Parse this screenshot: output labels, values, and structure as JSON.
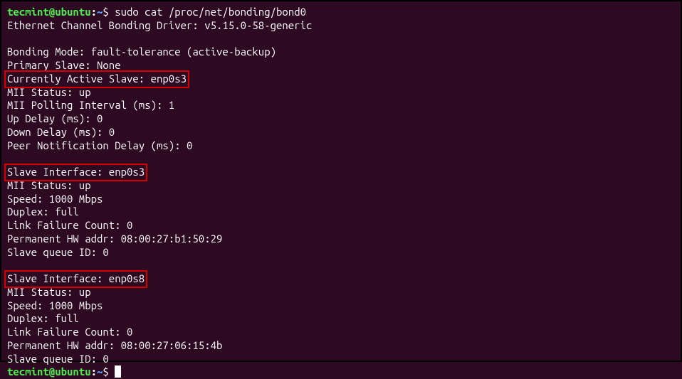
{
  "prompt": {
    "user": "tecmint@ubuntu",
    "path": "~",
    "symbol": "$"
  },
  "command": "sudo cat /proc/net/bonding/bond0",
  "header": {
    "driver": "Ethernet Channel Bonding Driver: v5.15.0-58-generic"
  },
  "bonding": {
    "mode": "Bonding Mode: fault-tolerance (active-backup)",
    "primary_slave": "Primary Slave: None",
    "active_slave": "Currently Active Slave: enp0s3",
    "mii_status": "MII Status: up",
    "mii_polling": "MII Polling Interval (ms): 1",
    "up_delay": "Up Delay (ms): 0",
    "down_delay": "Down Delay (ms): 0",
    "peer_notification": "Peer Notification Delay (ms): 0"
  },
  "slave1": {
    "interface": "Slave Interface: enp0s3",
    "mii_status": "MII Status: up",
    "speed": "Speed: 1000 Mbps",
    "duplex": "Duplex: full",
    "link_failure": "Link Failure Count: 0",
    "hw_addr": "Permanent HW addr: 08:00:27:b1:50:29",
    "queue_id": "Slave queue ID: 0"
  },
  "slave2": {
    "interface": "Slave Interface: enp0s8",
    "mii_status": "MII Status: up",
    "speed": "Speed: 1000 Mbps",
    "duplex": "Duplex: full",
    "link_failure": "Link Failure Count: 0",
    "hw_addr": "Permanent HW addr: 08:00:27:06:15:4b",
    "queue_id": "Slave queue ID: 0"
  }
}
